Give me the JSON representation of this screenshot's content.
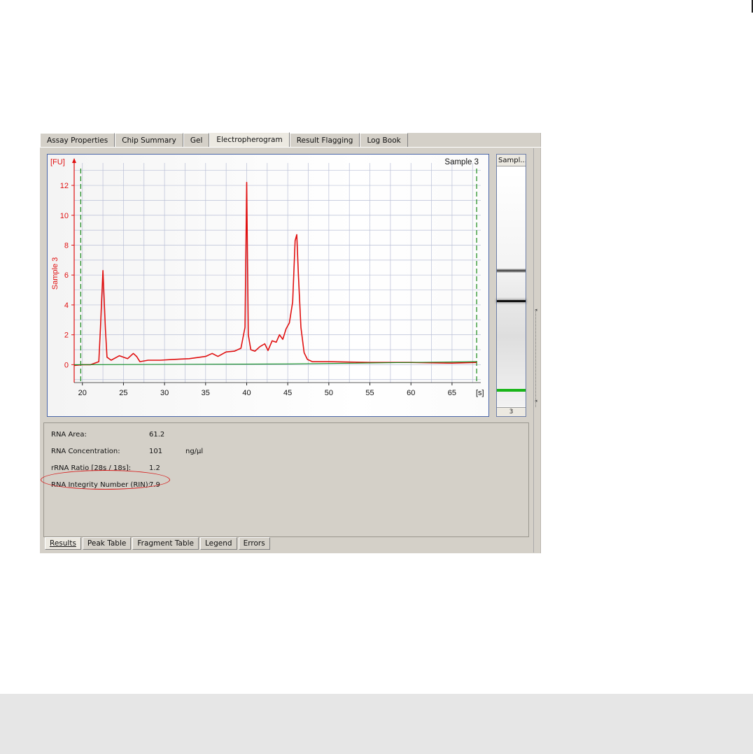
{
  "top_tabs": [
    {
      "label": "Assay Properties",
      "active": false
    },
    {
      "label": "Chip Summary",
      "active": false
    },
    {
      "label": "Gel",
      "active": false
    },
    {
      "label": "Electropherogram",
      "active": true
    },
    {
      "label": "Result Flagging",
      "active": false
    },
    {
      "label": "Log Book",
      "active": false
    }
  ],
  "electropherogram": {
    "sample_title": "Sample 3",
    "y_unit": "[FU]",
    "x_unit": "[s]",
    "y_axis_label": "Sample 3"
  },
  "chart_data": {
    "type": "line",
    "title": "Sample 3",
    "xlabel": "[s]",
    "ylabel": "Sample 3",
    "y_unit": "[FU]",
    "xlim": [
      19,
      68.5
    ],
    "ylim": [
      -1.2,
      13.5
    ],
    "x_ticks": [
      20,
      25,
      30,
      35,
      40,
      45,
      50,
      55,
      60,
      65
    ],
    "y_ticks": [
      0,
      2,
      4,
      6,
      8,
      10,
      12
    ],
    "grid": true,
    "series": [
      {
        "color": "#e01010",
        "x": [
          19.0,
          20.0,
          21.0,
          22.0,
          22.2,
          22.5,
          22.8,
          23.0,
          23.5,
          24.5,
          25.5,
          26.2,
          26.6,
          27.0,
          28.0,
          29.5,
          31.0,
          33.0,
          35.0,
          35.8,
          36.5,
          37.5,
          38.5,
          39.3,
          39.8,
          40.0,
          40.2,
          40.5,
          41.0,
          41.6,
          42.2,
          42.6,
          43.1,
          43.6,
          44.0,
          44.4,
          44.8,
          45.2,
          45.6,
          45.9,
          46.1,
          46.3,
          46.6,
          47.0,
          47.4,
          48.0,
          50.0,
          55.0,
          60.0,
          65.0,
          68.0
        ],
        "y": [
          -0.05,
          0.0,
          0.0,
          0.2,
          2.5,
          6.3,
          2.4,
          0.5,
          0.3,
          0.6,
          0.4,
          0.75,
          0.55,
          0.2,
          0.3,
          0.3,
          0.35,
          0.4,
          0.55,
          0.75,
          0.55,
          0.85,
          0.9,
          1.1,
          2.5,
          12.2,
          2.0,
          1.0,
          0.9,
          1.2,
          1.4,
          0.95,
          1.6,
          1.5,
          2.0,
          1.7,
          2.4,
          2.8,
          4.2,
          8.3,
          8.7,
          6.0,
          2.5,
          0.8,
          0.35,
          0.2,
          0.2,
          0.15,
          0.15,
          0.1,
          0.15
        ]
      },
      {
        "color": "#0a8c1e",
        "x": [
          19.0,
          45.0,
          68.0
        ],
        "y": [
          0.0,
          0.05,
          0.2
        ]
      }
    ],
    "markers": [
      {
        "x": 19.8,
        "color": "#1a8a1a",
        "style": "dashed"
      },
      {
        "x": 68.0,
        "color": "#1a8a1a",
        "style": "dashed"
      }
    ]
  },
  "sample_strip": {
    "header": "Sampl...",
    "footer": "3",
    "bands": [
      {
        "position": 0.42,
        "color": "#333333",
        "intensity": "medium"
      },
      {
        "position": 0.55,
        "color": "#111111",
        "intensity": "strong"
      },
      {
        "position": 0.93,
        "color": "#19b519",
        "intensity": "marker"
      }
    ]
  },
  "results": {
    "rna_area_label": "RNA Area:",
    "rna_area_value": "61.2",
    "rna_conc_label": "RNA Concentration:",
    "rna_conc_value": "101",
    "rna_conc_unit": "ng/µl",
    "rrna_ratio_label": "rRNA Ratio [28s / 18s]:",
    "rrna_ratio_value": "1.2",
    "rin_label": "RNA Integrity Number (RIN):",
    "rin_value": "7.9"
  },
  "bottom_tabs": [
    {
      "label": "Results",
      "active": true
    },
    {
      "label": "Peak Table",
      "active": false
    },
    {
      "label": "Fragment Table",
      "active": false
    },
    {
      "label": "Legend",
      "active": false
    },
    {
      "label": "Errors",
      "active": false
    }
  ],
  "colors": {
    "trace": "#e01010",
    "baseline": "#0a8c1e",
    "axis": "#e01010",
    "grid": "#b9bfd6",
    "rin_highlight": "#d81e1e"
  }
}
